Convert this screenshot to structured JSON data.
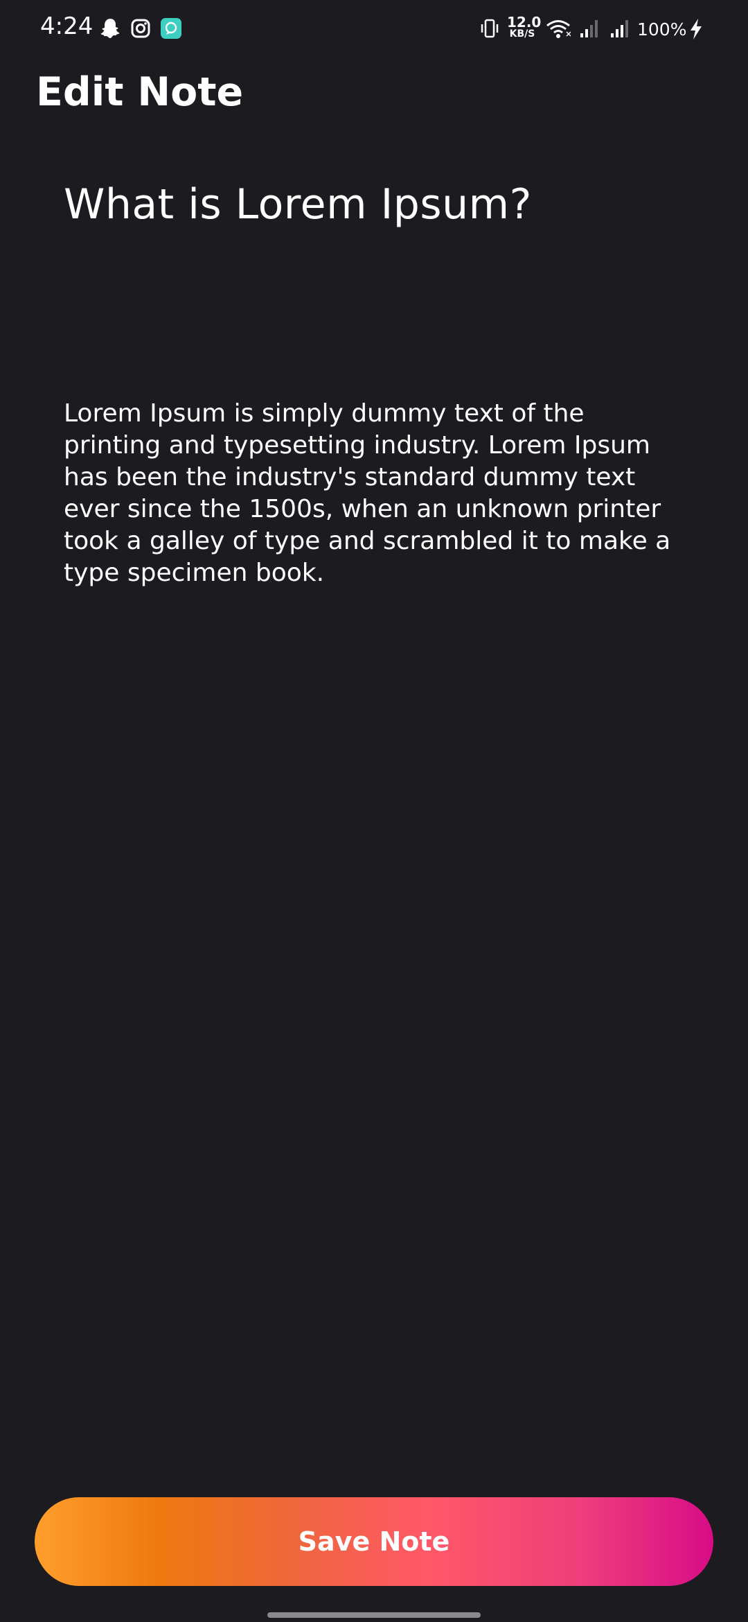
{
  "status_bar": {
    "time": "4:24",
    "net_speed_value": "12.0",
    "net_speed_unit": "KB/S",
    "battery": "100%",
    "icons": [
      "snapchat-icon",
      "instagram-icon",
      "chat-app-icon",
      "vibrate-icon",
      "wifi-icon",
      "signal-icon",
      "signal-icon",
      "charging-icon"
    ]
  },
  "header": {
    "title": "Edit Note"
  },
  "note": {
    "title": "What is Lorem Ipsum?",
    "body": "Lorem Ipsum is simply dummy text of the\nprinting and typesetting industry. Lorem Ipsum\nhas been the industry's standard dummy text\never since the 1500s, when an unknown printer\ntook a galley of type and scrambled it to make a\ntype specimen book."
  },
  "actions": {
    "save_label": "Save Note"
  },
  "colors": {
    "background": "#1c1b20",
    "text": "#ffffff",
    "button_gradient_start": "#ff9e2c",
    "button_gradient_end": "#d80c87"
  }
}
